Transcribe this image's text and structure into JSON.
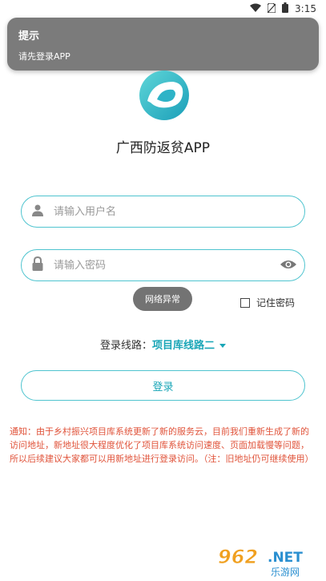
{
  "status_bar": {
    "time": "3:15"
  },
  "toast_top": {
    "title": "提示",
    "message": "请先登录APP"
  },
  "app": {
    "title": "广西防返贫APP"
  },
  "username": {
    "placeholder": "请输入用户名",
    "value": ""
  },
  "password": {
    "placeholder": "请输入密码",
    "value": ""
  },
  "toast_mid": {
    "text": "网络异常"
  },
  "remember": {
    "label": "记住密码",
    "checked": false
  },
  "route": {
    "label": "登录线路：",
    "value": "项目库线路二"
  },
  "login_button": {
    "label": "登录"
  },
  "notice": {
    "text": "通知：由于乡村振兴项目库系统更新了新的服务云，目前我们重新生成了新的访问地址，新地址很大程度优化了项目库系统访问速度、页面加载慢等问题，所以后续建议大家都可以用新地址进行登录访问。（注：旧地址仍可继续使用）"
  },
  "watermark": {
    "text": "962.NET 乐游网"
  },
  "colors": {
    "accent": "#4fc4cf",
    "accent_text": "#1aa6b7",
    "notice": "#e0533a",
    "toast_bg": "#7b7b7b"
  }
}
